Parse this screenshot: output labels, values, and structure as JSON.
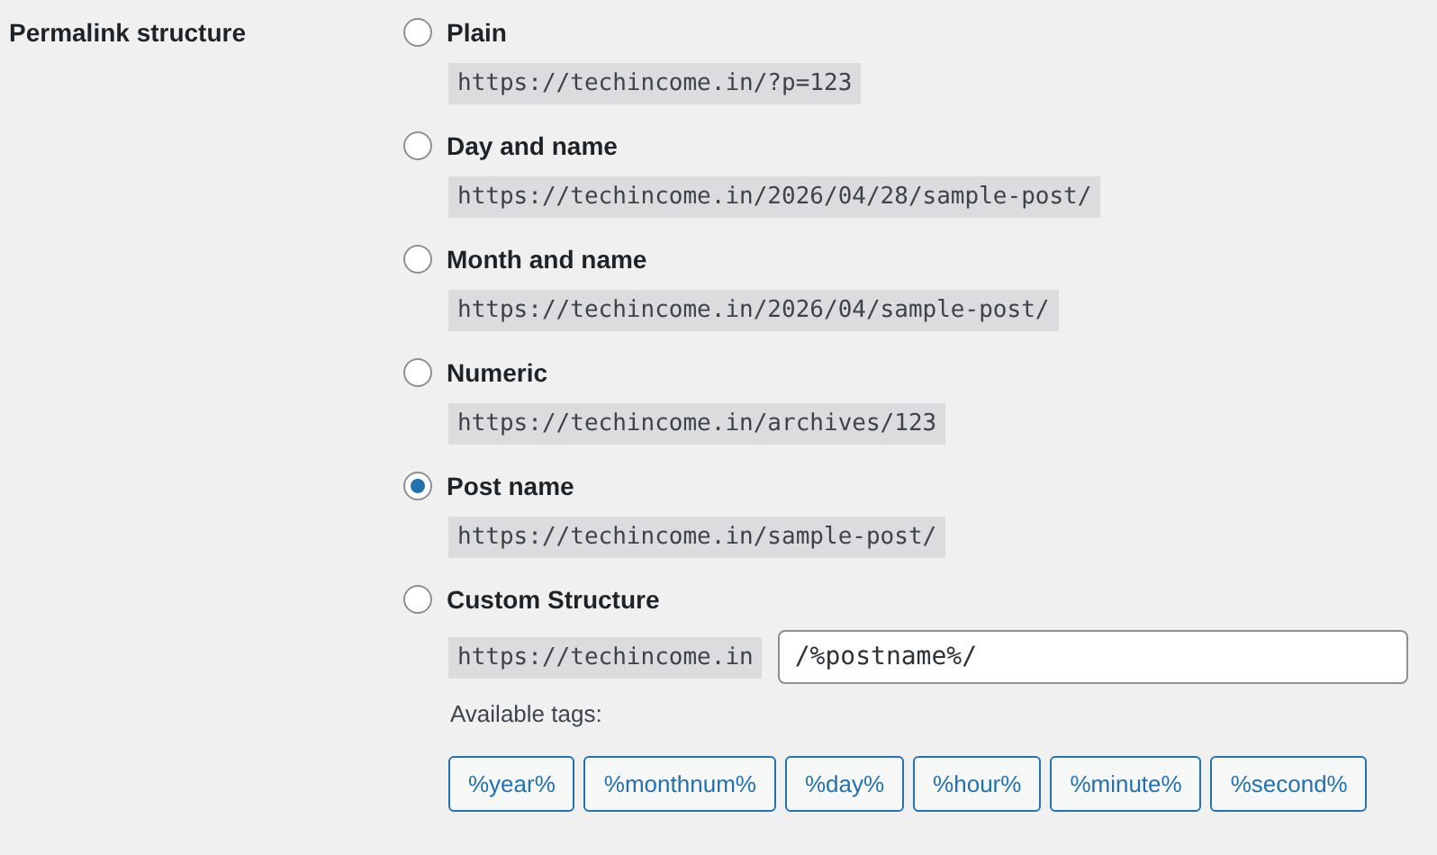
{
  "label": "Permalink structure",
  "options": [
    {
      "label": "Plain",
      "selected": false,
      "example": "https://techincome.in/?p=123"
    },
    {
      "label": "Day and name",
      "selected": false,
      "example": "https://techincome.in/2026/04/28/sample-post/"
    },
    {
      "label": "Month and name",
      "selected": false,
      "example": "https://techincome.in/2026/04/sample-post/"
    },
    {
      "label": "Numeric",
      "selected": false,
      "example": "https://techincome.in/archives/123"
    },
    {
      "label": "Post name",
      "selected": true,
      "example": "https://techincome.in/sample-post/"
    }
  ],
  "custom": {
    "label": "Custom Structure",
    "selected": false,
    "prefix": "https://techincome.in",
    "value": "/%postname%/",
    "tags_label": "Available tags:",
    "tags": [
      "%year%",
      "%monthnum%",
      "%day%",
      "%hour%",
      "%minute%",
      "%second%"
    ]
  }
}
